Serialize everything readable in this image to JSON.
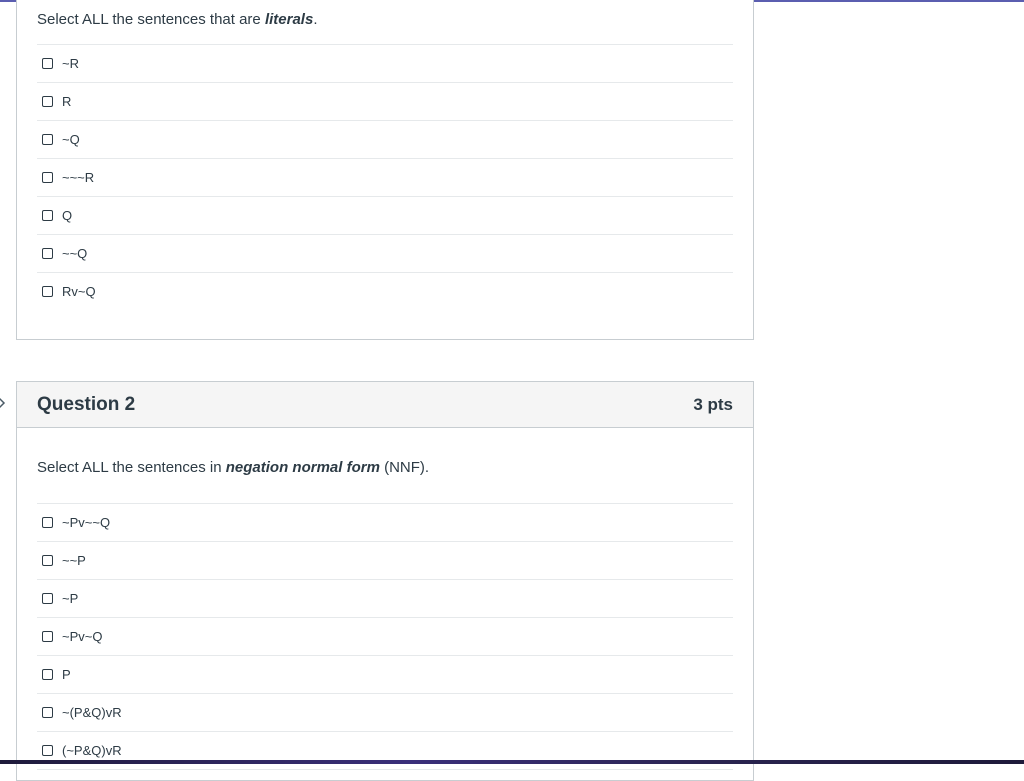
{
  "question1": {
    "prompt_prefix": "Select ALL the sentences that are ",
    "prompt_emphasis": "literals",
    "prompt_suffix": ".",
    "answers": [
      "~R",
      "R",
      "~Q",
      "~~~R",
      "Q",
      "~~Q",
      "Rv~Q"
    ]
  },
  "question2": {
    "title": "Question 2",
    "points": "3 pts",
    "prompt_prefix": "Select ALL the sentences in ",
    "prompt_emphasis": "negation normal form",
    "prompt_suffix": " (NNF).",
    "answers": [
      "~Pv~~Q",
      "~~P",
      "~P",
      "~Pv~Q",
      "P",
      "~(P&Q)vR",
      "(~P&Q)vR"
    ]
  },
  "colors": {
    "accent": "#5b5eb0",
    "text": "#2d3b45",
    "border": "#c7cdd1",
    "header_bg": "#f5f5f5"
  }
}
